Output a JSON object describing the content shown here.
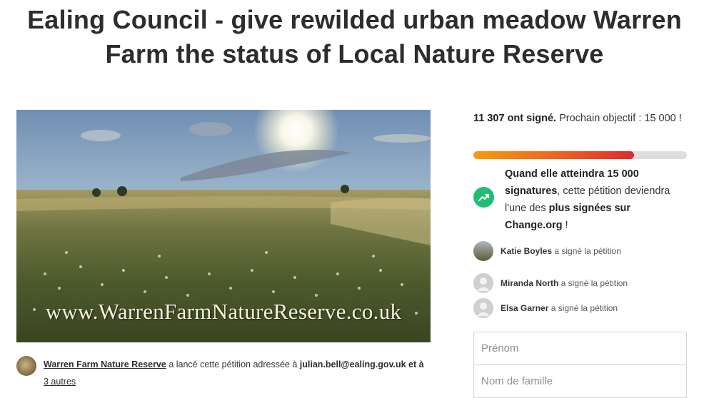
{
  "title": "Ealing Council - give rewilded urban meadow Warren Farm the status of Local Nature Reserve",
  "hero": {
    "caption": "www.WarrenFarmNatureReserve.co.uk"
  },
  "starter": {
    "name": "Warren Farm Nature Reserve",
    "action": " a lancé cette pétition adressée à ",
    "recipient": "julian.bell@ealing.gov.uk",
    "and": " et à ",
    "others_link": "3 autres"
  },
  "stats": {
    "signed_count": "11 307 ont signé.",
    "next_goal_label": " Prochain objectif : 15 000 !",
    "progress_fraction": 0.754
  },
  "milestone": {
    "part1": "Quand elle atteindra 15 000 signatures",
    "part2": ", cette pétition deviendra l'une des ",
    "part3": "plus signées sur Change.org",
    "part4": " !"
  },
  "recent_signers": [
    {
      "name": "Katie Boyles",
      "action": " a signé la pétition"
    },
    {
      "name": "Miranda North",
      "action": " a signé la pétition"
    },
    {
      "name": "Elsa Garner",
      "action": " a signé la pétition"
    }
  ],
  "form": {
    "first_name_placeholder": "Prénom",
    "last_name_placeholder": "Nom de famille"
  },
  "colors": {
    "progress_start": "#f39c12",
    "progress_end": "#e0292b",
    "milestone_badge": "#1fbf73"
  }
}
